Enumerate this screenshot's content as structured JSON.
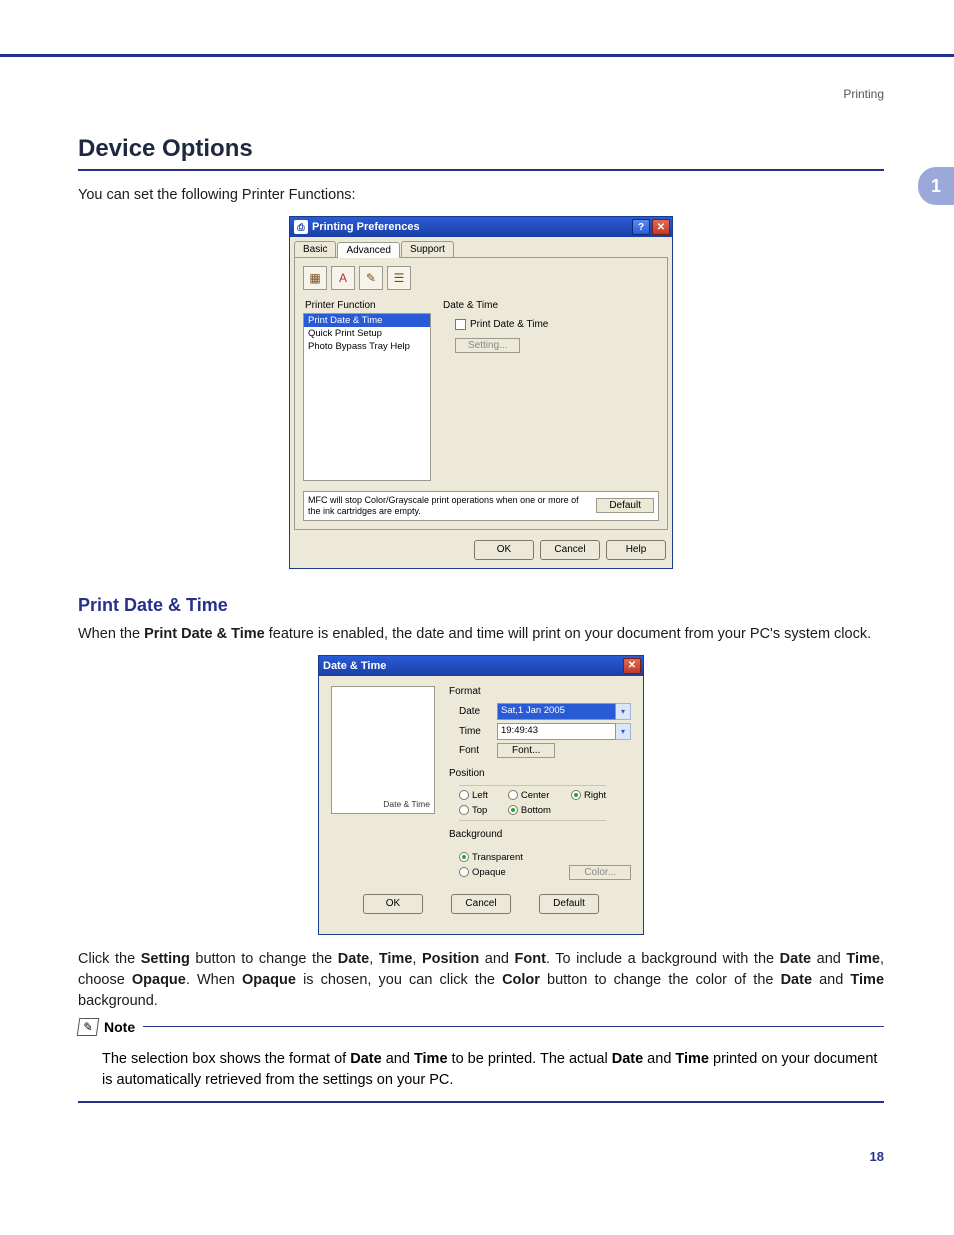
{
  "running_head": "Printing",
  "side_tab": "1",
  "section_title": "Device Options",
  "lead_text": "You can set the following Printer Functions:",
  "page_number": "18",
  "pp": {
    "title": "Printing Preferences",
    "help_btn": "?",
    "close_btn": "✕",
    "tabs": {
      "basic": "Basic",
      "advanced": "Advanced",
      "support": "Support"
    },
    "printer_function_label": "Printer Function",
    "func_items": {
      "a": "Print Date & Time",
      "b": "Quick Print Setup",
      "c": "Photo Bypass Tray Help"
    },
    "group_title": "Date & Time",
    "checkbox_label": "Print Date & Time",
    "setting_btn": "Setting...",
    "footer_note": "MFC will stop Color/Grayscale print operations when one or more of the ink cartridges are empty.",
    "default_btn": "Default",
    "ok": "OK",
    "cancel": "Cancel",
    "help": "Help"
  },
  "sub_title": "Print Date & Time",
  "para1_a": "When the ",
  "para1_b": "Print Date & Time",
  "para1_c": " feature is enabled, the date and time will print on your document from your PC's system clock.",
  "dt": {
    "title": "Date & Time",
    "close_btn": "✕",
    "preview_label": "Date & Time",
    "format_label": "Format",
    "date_label": "Date",
    "date_value": "Sat,1 Jan 2005",
    "time_label": "Time",
    "time_value": "19:49:43",
    "font_label": "Font",
    "font_btn": "Font...",
    "position_label": "Position",
    "pos": {
      "left": "Left",
      "center": "Center",
      "right": "Right",
      "top": "Top",
      "bottom": "Bottom"
    },
    "background_label": "Background",
    "bg_transparent": "Transparent",
    "bg_opaque": "Opaque",
    "color_btn": "Color...",
    "ok": "OK",
    "cancel": "Cancel",
    "default": "Default"
  },
  "para2_a": "Click the ",
  "para2_b": "Setting",
  "para2_c": " button to change the ",
  "para2_d": "Date",
  "para2_e": ", ",
  "para2_f": "Time",
  "para2_g": ", ",
  "para2_h": "Position",
  "para2_i": " and ",
  "para2_j": "Font",
  "para2_k": ". To include a background with the ",
  "para2_l": "Date",
  "para2_m": " and ",
  "para2_n": "Time",
  "para2_o": ", choose ",
  "para2_p": "Opaque",
  "para2_q": ". When ",
  "para2_r": "Opaque",
  "para2_s": " is chosen, you can click the ",
  "para2_t": "Color",
  "para2_u": " button to change the color of the ",
  "para2_v": "Date",
  "para2_w": " and ",
  "para2_x": "Time",
  "para2_y": " background.",
  "note_title": "Note",
  "note_a": "The selection box shows the format of ",
  "note_b": "Date",
  "note_c": " and ",
  "note_d": "Time",
  "note_e": " to be printed. The actual ",
  "note_f": "Date",
  "note_g": " and ",
  "note_h": "Time",
  "note_i": " printed on your document is automatically retrieved from the settings on your PC."
}
